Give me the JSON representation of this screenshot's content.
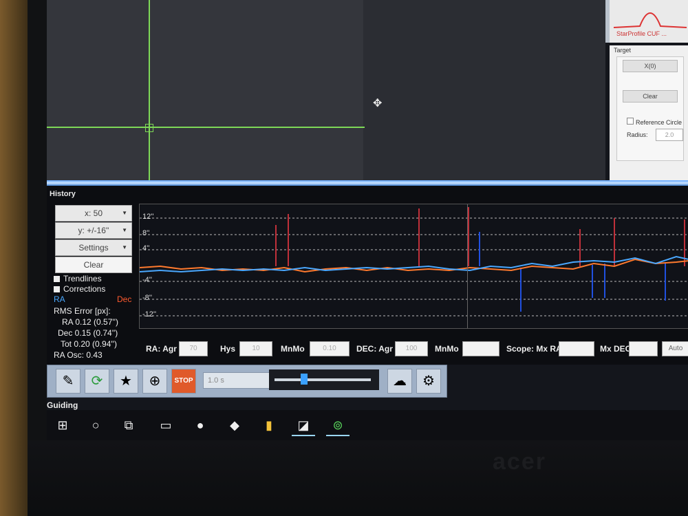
{
  "camera": {
    "lock_color": "#7ed957"
  },
  "profile": {
    "label": "StarProfile CUF ..."
  },
  "target": {
    "title": "Target",
    "zoom_value": "X(0)",
    "clear_label": "Clear",
    "reference_circle_label": "Reference Circle",
    "radius_label": "Radius:",
    "radius_value": "2.0"
  },
  "history": {
    "title": "History",
    "x_scale": "x: 50",
    "y_scale": "y: +/-16''",
    "settings_label": "Settings",
    "clear_label": "Clear",
    "trendlines_label": "Trendlines",
    "corrections_label": "Corrections",
    "ra_label": "RA",
    "dec_label": "Dec",
    "rms_title": "RMS Error [px]:",
    "rms_ra": "RA  0.12 (0.57'')",
    "rms_dec": "Dec  0.15 (0.74'')",
    "rms_tot": "Tot  0.20 (0.94'')",
    "ra_osc": "RA Osc: 0.43",
    "y_labels": [
      "12''",
      "8''",
      "4''",
      "-4''",
      "-8''",
      "-12''"
    ],
    "ra_color": "#4aa8ff",
    "dec_color": "#ff7a2e",
    "controls": {
      "ra_agr_label": "RA: Agr",
      "ra_agr_value": "70",
      "hys_label": "Hys",
      "hys_value": "10",
      "mnmo_label": "MnMo",
      "mnmo_value": "0.10",
      "dec_agr_label": "DEC: Agr",
      "dec_agr_value": "100",
      "dec_mnmo_label": "MnMo",
      "dec_mnmo_value": "",
      "scope_mx_ra_label": "Scope: Mx RA",
      "scope_mx_ra_value": "",
      "mx_dec_label": "Mx DEC",
      "mx_dec_value": "",
      "auto_label": "Auto"
    }
  },
  "toolbar": {
    "exposure_value": "1.0 s",
    "stop_label": "STOP"
  },
  "status": {
    "guiding_label": "Guiding"
  },
  "taskbar": {
    "items": [
      "start-icon",
      "cortana-icon",
      "task-view-icon",
      "file-explorer-icon",
      "browser-icon",
      "store-icon",
      "notes-icon",
      "phd2-icon",
      "target-app-icon"
    ]
  },
  "brand": {
    "logo": "acer"
  }
}
